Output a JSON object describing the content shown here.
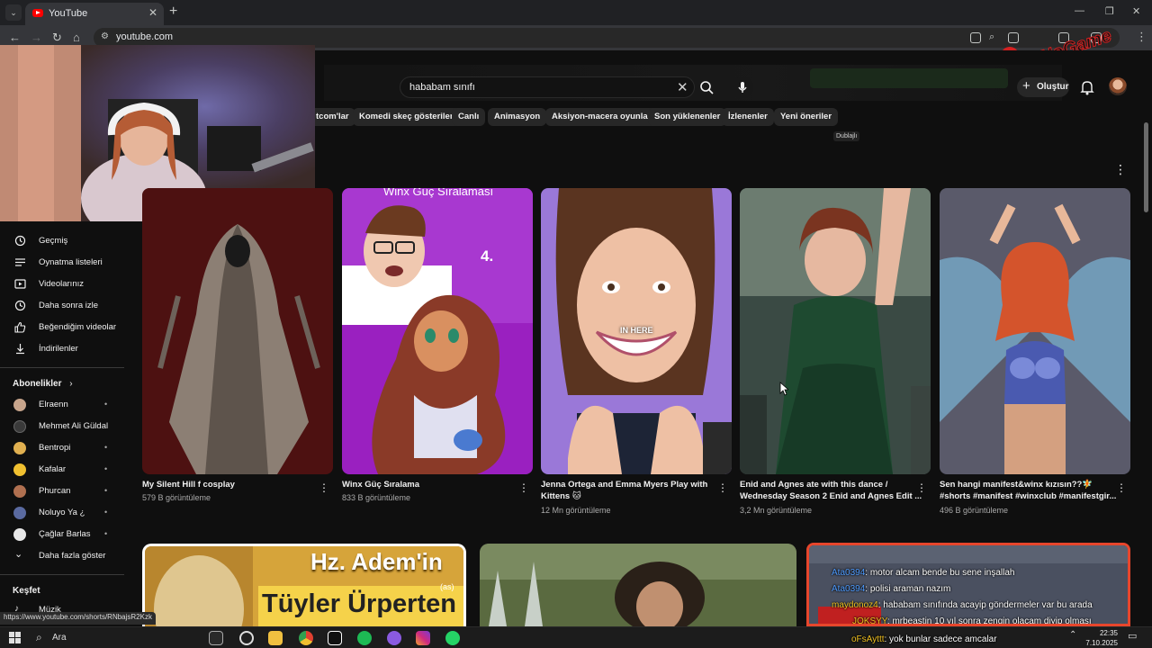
{
  "browser": {
    "tab_title": "YouTube",
    "url": "youtube.com",
    "status_url": "https://www.youtube.com/shorts/RNbajsR2Kzk"
  },
  "watermark": {
    "text": "ByNoGame"
  },
  "youtube": {
    "search": {
      "query": "hababam sınıfı"
    },
    "create_label": "Oluştur",
    "chips": [
      "tcom'lar",
      "Komedi skeç gösterileri",
      "Canlı",
      "Animasyon",
      "Aksiyon-macera oyunları",
      "Son yüklenenler",
      "İzlenenler",
      "Yeni öneriler"
    ],
    "dubbed_badge": "Dublajlı"
  },
  "sidebar": {
    "you_items": [
      {
        "label": "Geçmiş",
        "icon": "history-icon"
      },
      {
        "label": "Oynatma listeleri",
        "icon": "playlist-icon"
      },
      {
        "label": "Videolarınız",
        "icon": "your-videos-icon"
      },
      {
        "label": "Daha sonra izle",
        "icon": "watch-later-icon"
      },
      {
        "label": "Beğendiğim videolar",
        "icon": "like-icon"
      },
      {
        "label": "İndirilenler",
        "icon": "download-icon"
      }
    ],
    "subscriptions_heading": "Abonelikler",
    "subscriptions": [
      {
        "label": "Elraenn",
        "color": "#c8a58c"
      },
      {
        "label": "Mehmet Ali Güldal",
        "color": "#3a3a3a"
      },
      {
        "label": "Bentropi",
        "color": "#e0b050"
      },
      {
        "label": "Kafalar",
        "color": "#f0c030"
      },
      {
        "label": "Phurcan",
        "color": "#b07050"
      },
      {
        "label": "Noluyo Ya ¿",
        "color": "#5a6aa0"
      },
      {
        "label": "Çağlar Barlas",
        "color": "#e8e8e8"
      }
    ],
    "show_more": "Daha fazla göster",
    "explore_heading": "Keşfet",
    "explore_first": "Müzik"
  },
  "shorts": [
    {
      "title_line1": "My Silent Hill f cosplay",
      "title_line2": "",
      "views": "579 B görüntüleme"
    },
    {
      "title_line1": "Winx Güç Sıralama",
      "title_line2": "",
      "views": "833 B görüntüleme",
      "overlay_title": "Winx Güç Sıralaması",
      "overlay_number": "4."
    },
    {
      "title_line1": "Jenna Ortega and Emma Myers Play with",
      "title_line2": "Kittens 🐱",
      "views": "12 Mn görüntüleme",
      "overlay_caption": "IN HERE"
    },
    {
      "title_line1": "Enid and Agnes ate with this dance /",
      "title_line2": "Wednesday Season 2 Enid and Agnes Edit ...",
      "views": "3,2 Mn görüntüleme"
    },
    {
      "title_line1": "Sen hangi manifest&winx kızısın??🧚",
      "title_line2": "#shorts #manifest #winxclub #manifestgir...",
      "views": "496 B görüntüleme"
    }
  ],
  "row2": {
    "thumb1_line1": "Hz. Adem'in",
    "thumb1_sup": "(as)",
    "thumb1_line2": "Tüyler Ürperten"
  },
  "chat": [
    {
      "user": "Ata0394",
      "text": ": motor alcam bende bu sene inşallah",
      "user_color": "#4f9cff"
    },
    {
      "user": "Ata0394",
      "text": ": polisi araman nazım",
      "user_color": "#4f9cff"
    },
    {
      "user": "maydonoz4",
      "text": ": hababam sınıfında acayip göndermeler var bu arada",
      "user_color": "#f0c020"
    },
    {
      "user": "JOKSYY",
      "text": ": mrbeastin 10 yıl sonra zengin olacam diyip olması",
      "user_color": "#f0c020"
    },
    {
      "user": "oFsAyttt",
      "text": ": yok bunlar sadece amcalar",
      "user_color": "#f0c020"
    }
  ],
  "taskbar": {
    "search_label": "Ara",
    "time": "22:35",
    "date": "7.10.2025"
  }
}
